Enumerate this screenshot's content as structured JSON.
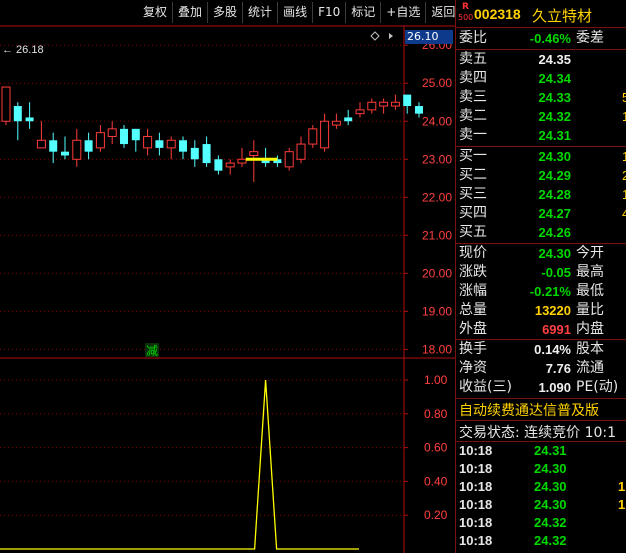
{
  "toolbar": {
    "buttons": [
      "复权",
      "叠加",
      "多股",
      "统计",
      "画线",
      "F10",
      "标记",
      "+自选",
      "返回"
    ]
  },
  "chart": {
    "high_marker": "26.18",
    "price_badge": "26.10",
    "price_ticks": [
      "26.00",
      "25.00",
      "24.00",
      "23.00",
      "22.00",
      "21.00",
      "20.00",
      "19.00",
      "18.00"
    ],
    "indicator_ticks": [
      "1.00",
      "0.80",
      "0.60",
      "0.40",
      "0.20"
    ],
    "reduce_marker": "减",
    "colors": {
      "up": "#ff3b3b",
      "down": "#54ffff",
      "ma": "#ffff00",
      "grid": "#8b0000",
      "axis": "#b01010"
    }
  },
  "chart_data": {
    "type": "candlestick",
    "ylim": [
      17.8,
      26.4
    ],
    "candles": [
      {
        "o": 24.0,
        "c": 24.9,
        "h": 24.9,
        "l": 23.9
      },
      {
        "o": 24.4,
        "c": 24.0,
        "h": 24.5,
        "l": 23.5
      },
      {
        "o": 24.1,
        "c": 24.0,
        "h": 24.5,
        "l": 23.8
      },
      {
        "o": 23.3,
        "c": 23.5,
        "h": 24.0,
        "l": 23.3
      },
      {
        "o": 23.5,
        "c": 23.2,
        "h": 23.7,
        "l": 22.9
      },
      {
        "o": 23.2,
        "c": 23.1,
        "h": 23.6,
        "l": 23.0
      },
      {
        "o": 23.0,
        "c": 23.5,
        "h": 23.8,
        "l": 22.8
      },
      {
        "o": 23.5,
        "c": 23.2,
        "h": 23.7,
        "l": 23.0
      },
      {
        "o": 23.3,
        "c": 23.7,
        "h": 23.9,
        "l": 23.2
      },
      {
        "o": 23.6,
        "c": 23.8,
        "h": 24.0,
        "l": 23.4
      },
      {
        "o": 23.8,
        "c": 23.4,
        "h": 23.9,
        "l": 23.3
      },
      {
        "o": 23.8,
        "c": 23.5,
        "h": 23.8,
        "l": 23.2
      },
      {
        "o": 23.3,
        "c": 23.6,
        "h": 23.8,
        "l": 23.1
      },
      {
        "o": 23.5,
        "c": 23.3,
        "h": 23.7,
        "l": 23.1
      },
      {
        "o": 23.3,
        "c": 23.5,
        "h": 23.6,
        "l": 23.0
      },
      {
        "o": 23.5,
        "c": 23.2,
        "h": 23.6,
        "l": 23.0
      },
      {
        "o": 23.3,
        "c": 23.0,
        "h": 23.5,
        "l": 22.8
      },
      {
        "o": 23.4,
        "c": 22.9,
        "h": 23.6,
        "l": 22.8
      },
      {
        "o": 23.0,
        "c": 22.7,
        "h": 23.1,
        "l": 22.6
      },
      {
        "o": 22.8,
        "c": 22.9,
        "h": 23.0,
        "l": 22.6
      },
      {
        "o": 22.9,
        "c": 23.0,
        "h": 23.3,
        "l": 22.8
      },
      {
        "o": 23.1,
        "c": 23.2,
        "h": 23.5,
        "l": 22.4
      },
      {
        "o": 23.0,
        "c": 22.9,
        "h": 23.3,
        "l": 22.8
      },
      {
        "o": 23.0,
        "c": 22.9,
        "h": 23.1,
        "l": 22.8
      },
      {
        "o": 22.8,
        "c": 23.2,
        "h": 23.3,
        "l": 22.7
      },
      {
        "o": 23.0,
        "c": 23.4,
        "h": 23.6,
        "l": 22.9
      },
      {
        "o": 23.4,
        "c": 23.8,
        "h": 23.9,
        "l": 23.3
      },
      {
        "o": 23.3,
        "c": 24.0,
        "h": 24.2,
        "l": 23.2
      },
      {
        "o": 23.9,
        "c": 24.0,
        "h": 24.2,
        "l": 23.8
      },
      {
        "o": 24.1,
        "c": 24.0,
        "h": 24.3,
        "l": 23.9
      },
      {
        "o": 24.2,
        "c": 24.3,
        "h": 24.5,
        "l": 24.1
      },
      {
        "o": 24.3,
        "c": 24.5,
        "h": 24.6,
        "l": 24.2
      },
      {
        "o": 24.4,
        "c": 24.5,
        "h": 24.6,
        "l": 24.2
      },
      {
        "o": 24.4,
        "c": 24.5,
        "h": 24.7,
        "l": 24.3
      },
      {
        "o": 24.7,
        "c": 24.4,
        "h": 24.7,
        "l": 24.2
      },
      {
        "o": 24.4,
        "c": 24.2,
        "h": 24.5,
        "l": 24.1
      }
    ],
    "ma_segment": {
      "from_index": 21,
      "to_index": 23,
      "value": 23.0
    },
    "indicator": {
      "ylim": [
        0,
        1.0
      ],
      "spike_index": 22,
      "spike_value": 1.0
    }
  },
  "quote": {
    "r_logo": "R",
    "r_num": "500",
    "code": "002318",
    "name": "久立特材",
    "weibi_label": "委比",
    "weibi_value": "-0.46%",
    "weicha_label": "委差",
    "asks": [
      {
        "label": "卖五",
        "price": "24.35",
        "color": "white",
        "vol": ""
      },
      {
        "label": "卖四",
        "price": "24.34",
        "color": "green",
        "vol": ""
      },
      {
        "label": "卖三",
        "price": "24.33",
        "color": "green",
        "vol": "5"
      },
      {
        "label": "卖二",
        "price": "24.32",
        "color": "green",
        "vol": "1"
      },
      {
        "label": "卖一",
        "price": "24.31",
        "color": "green",
        "vol": ""
      }
    ],
    "bids": [
      {
        "label": "买一",
        "price": "24.30",
        "color": "green",
        "vol": "1"
      },
      {
        "label": "买二",
        "price": "24.29",
        "color": "green",
        "vol": "2"
      },
      {
        "label": "买三",
        "price": "24.28",
        "color": "green",
        "vol": "1"
      },
      {
        "label": "买四",
        "price": "24.27",
        "color": "green",
        "vol": "4"
      },
      {
        "label": "买五",
        "price": "24.26",
        "color": "green",
        "vol": ""
      }
    ],
    "stats": [
      {
        "label": "现价",
        "value": "24.30",
        "color": "green",
        "label2": "今开"
      },
      {
        "label": "涨跌",
        "value": "-0.05",
        "color": "green",
        "label2": "最高"
      },
      {
        "label": "涨幅",
        "value": "-0.21%",
        "color": "green",
        "label2": "最低"
      },
      {
        "label": "总量",
        "value": "13220",
        "color": "yellow",
        "label2": "量比"
      },
      {
        "label": "外盘",
        "value": "6991",
        "color": "red",
        "label2": "内盘"
      }
    ],
    "fundamentals": [
      {
        "label": "换手",
        "value": "0.14%",
        "label2": "股本"
      },
      {
        "label": "净资",
        "value": "7.76",
        "label2": "流通"
      },
      {
        "label": "收益(三)",
        "value": "1.090",
        "label2": "PE(动)"
      }
    ],
    "ad_text": "自动续费通达信普及版",
    "trade_status": "交易状态: 连续竞价 10:1",
    "ticks": [
      {
        "time": "10:18",
        "price": "24.31",
        "vol": ""
      },
      {
        "time": "10:18",
        "price": "24.30",
        "vol": ""
      },
      {
        "time": "10:18",
        "price": "24.30",
        "vol": "1"
      },
      {
        "time": "10:18",
        "price": "24.30",
        "vol": "1"
      },
      {
        "time": "10:18",
        "price": "24.32",
        "vol": ""
      },
      {
        "time": "10:18",
        "price": "24.32",
        "vol": ""
      }
    ]
  }
}
